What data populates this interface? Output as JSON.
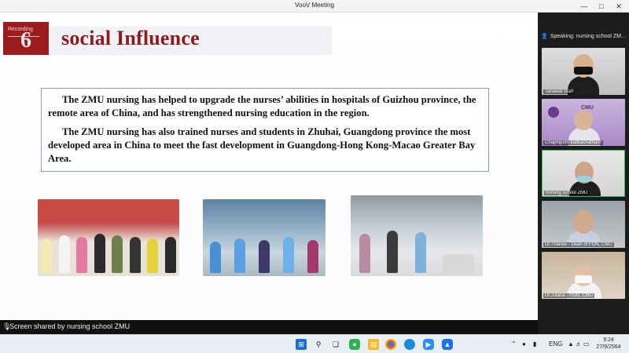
{
  "window": {
    "title": "VooV Meeting"
  },
  "slide": {
    "badge_label": "Recording",
    "badge_number": "6",
    "title": "social Influence",
    "paragraphs": [
      "The ZMU nursing has helped to upgrade the nurses’ abilities in hospitals of Guizhou province, the remote area of China, and has strengthened nursing education in the region.",
      "The ZMU nursing has also trained nurses and students in Zhuhai, Guangdong province the most developed area in China to meet the fast development in Guangdong-Hong Kong-Macao Greater Bay Area."
    ]
  },
  "share_status": {
    "text": "Screen shared by nursing school ZMU",
    "icon": "mic-icon"
  },
  "panel": {
    "speaking": "Speaking: nursing school ZM...",
    "participants": [
      {
        "name": "Tanawat Staff"
      },
      {
        "name": "Chaphiporn kiatkachatharn"
      },
      {
        "name": "nursing school ZMU"
      },
      {
        "name": "Dr.Thanee - Dean of FON, CMU"
      },
      {
        "name": "Dr.Jutarat - FON, CMU"
      }
    ],
    "cmu_logo_text": "CMU"
  },
  "taskbar": {
    "language": "ENG",
    "time": "9:24",
    "date": "27/9/2564",
    "apps": [
      "windows-start",
      "search",
      "task-view",
      "line",
      "file-explorer",
      "chrome",
      "edge",
      "zoom",
      "voov"
    ]
  },
  "colors": {
    "accent": "#9b1b1e",
    "title_red": "#8e1a1d",
    "active_border": "#2fbf5a"
  }
}
